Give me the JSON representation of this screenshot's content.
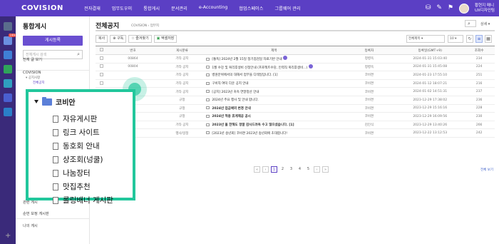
{
  "topbar": {
    "logo": "COVISION",
    "nav": [
      "전자결재",
      "업무도우미",
      "통합게시",
      "문서관리",
      "e-Accounting",
      "협업스페이스",
      "그룹웨어 관리"
    ],
    "user_name": "황현지 매니",
    "user_dept": "UX디자인팀"
  },
  "rail": {
    "badge": "199"
  },
  "sidebar": {
    "title": "통합게시",
    "write_button": "게시등록",
    "search_placeholder": "전체게시 검색",
    "items": {
      "all_posts": "전체 글 보기",
      "covision": "COVISION",
      "notice_group": "▾ 공지사항",
      "notice_all": "전체공지",
      "related": "관련 게시",
      "sorted": "순번 보정 게시판",
      "my_posts": "나의 게시"
    }
  },
  "main": {
    "title": "전체공지",
    "breadcrumb": "COVISION › 업무지",
    "detail": "상세 ▾",
    "toolbar": {
      "copy": "복사",
      "subscribe": "구독",
      "favorite": "즐겨찾기",
      "excel": "엑셀저장"
    },
    "filter": "전체제목",
    "page_size": "10",
    "columns": [
      "번호",
      "게시분류",
      "제목",
      "등록자",
      "등록일(GMT+9)",
      "조회수"
    ],
    "rows": [
      {
        "no": "00864",
        "cat": "기타 공지",
        "title": "[통독] 2024년 2월 15일 정기점검일 자료기반 안내",
        "author": "정병옥",
        "date": "2024-01-31 15:03:40",
        "views": "234",
        "badge": true
      },
      {
        "no": "00804",
        "cat": "기타 공지",
        "title": "1월 수강 및 복리후생비 신청안내 (프로젝트수당, 인력직 복리후생비...)",
        "author": "정병옥",
        "date": "2024-01-31 15:45:08",
        "views": "224",
        "badge": true
      },
      {
        "no": "",
        "cat": "기타 공지",
        "title": "병원분위에서의 대해서 업무을 디테일입니다.",
        "author": "코비젼",
        "date": "2024-01-23 17:55:10",
        "views": "251",
        "comments": "[1]"
      },
      {
        "no": "",
        "cat": "기타 공지",
        "title": "구비직 여덕 다운 공지 안내",
        "author": "코비젼",
        "date": "2024-01-12 18:07:21",
        "views": "216"
      },
      {
        "no": "",
        "cat": "기타 공지",
        "title": "[공지] 2023년 귀속 연말정산 안내",
        "author": "코비젼",
        "date": "2024-01-02 14:51:31",
        "views": "237"
      },
      {
        "no": "",
        "cat": "규정",
        "title": "2024년 주요 행사 및 안내 합니다.",
        "author": "코비젼",
        "date": "2023-12-29 17:38:02",
        "views": "236"
      },
      {
        "no": "",
        "cat": "규정",
        "title": "2024년 업금예외 변경 안내",
        "author": "코비젼",
        "date": "2023-12-29 15:16:16",
        "views": "228",
        "bold": true
      },
      {
        "no": "",
        "cat": "규정",
        "title": "2024년 적용 휴게제공 공시",
        "author": "코비젼",
        "date": "2023-12-29 16:09:56",
        "views": "230",
        "bold": true
      },
      {
        "no": "",
        "cat": "기타 공지",
        "title": "2023년 올 한해도 정말 감사드려옥 수고 많으셨습니다.",
        "author": "김인식",
        "date": "2023-12-29 13:40:26",
        "views": "266",
        "bold": true,
        "comments": "[1]"
      },
      {
        "no": "",
        "cat": "행사/일정",
        "title": "[2023년 송년회] 코비젼 2023년 송년회에 초대합니다!",
        "author": "코비젼",
        "date": "2023-12-22 13:12:53",
        "views": "242"
      }
    ],
    "pages": [
      "1",
      "2",
      "3",
      "4",
      "5"
    ],
    "total_link": "전체 보기"
  },
  "callout": {
    "category": "코비안",
    "items": [
      "자유게시판",
      "링크 사이트",
      "동호회 안내",
      "상조회(넝쿨)",
      "나눔장터",
      "맛집추천",
      "롤링배너 게시판"
    ]
  },
  "colors": {
    "brand": "#5b3fc4",
    "highlight": "#22c79c"
  }
}
